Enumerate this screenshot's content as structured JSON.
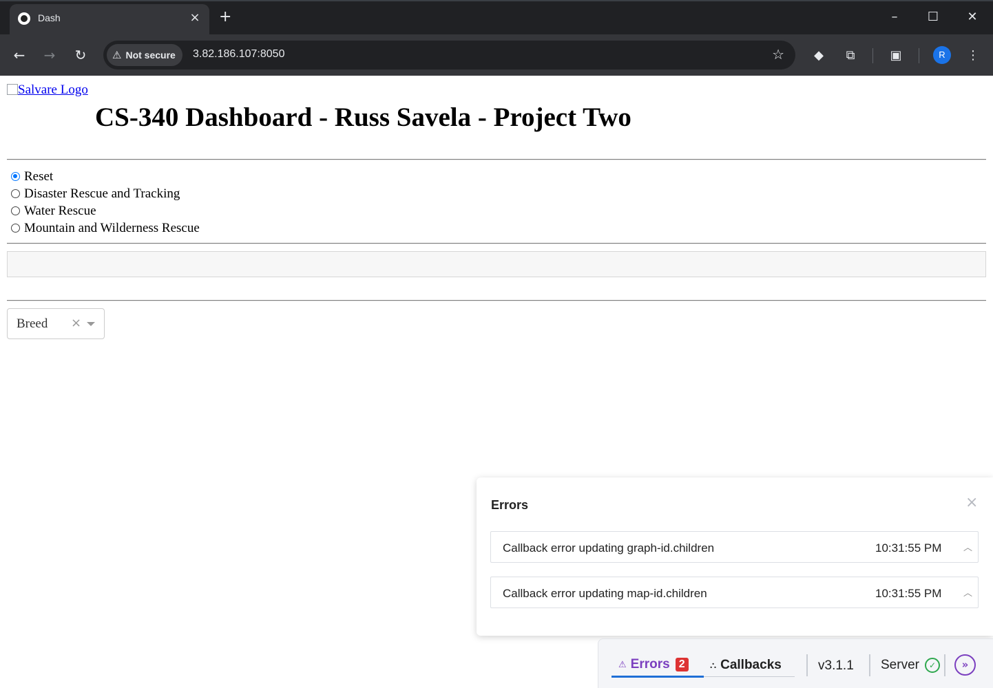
{
  "browser": {
    "tab_title": "Dash",
    "security_label": "Not secure",
    "url": "3.82.186.107:8050",
    "profile_initial": "R",
    "icons": {
      "back": "arrow-left-icon",
      "forward": "arrow-right-icon",
      "reload": "reload-icon",
      "bookmark": "star-icon",
      "extensions": "puzzle-icon",
      "minimize": "minimize-icon",
      "maximize": "maximize-icon",
      "close": "close-icon"
    }
  },
  "page": {
    "logo_alt": "Salvare Logo",
    "title": "CS-340 Dashboard - Russ Savela - Project Two",
    "filter_options": [
      {
        "label": "Reset",
        "checked": true
      },
      {
        "label": "Disaster Rescue and Tracking",
        "checked": false
      },
      {
        "label": "Water Rescue",
        "checked": false
      },
      {
        "label": "Mountain and Wilderness Rescue",
        "checked": false
      }
    ],
    "dropdown": {
      "value": "Breed"
    }
  },
  "devtools": {
    "errors_panel": {
      "title": "Errors",
      "items": [
        {
          "message": "Callback error updating graph-id.children",
          "time": "10:31:55 PM"
        },
        {
          "message": "Callback error updating map-id.children",
          "time": "10:31:55 PM"
        }
      ]
    },
    "bar": {
      "errors_label": "Errors",
      "errors_count": "2",
      "callbacks_label": "Callbacks",
      "version": "v3.1.1",
      "server_label": "Server"
    },
    "colors": {
      "accent": "#7b3fbf",
      "badge": "#dd3333",
      "ok": "#2fa84f",
      "tab_underline": "#1f6fd6"
    }
  }
}
